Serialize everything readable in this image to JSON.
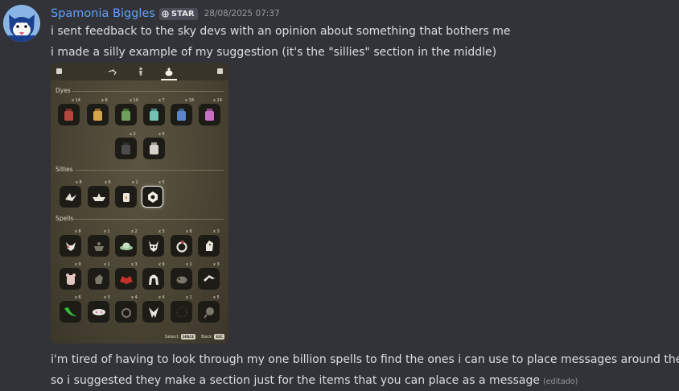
{
  "message": {
    "username": "Spamonia Biggles",
    "tag": "STAR",
    "timestamp": "28/08/2025 07:37",
    "lines": [
      "i sent feedback to the sky devs with an opinion about something that bothers me",
      "i made a silly example of my suggestion (it's the \"sillies\" section in the middle)",
      "i'm tired of having to look through my one billion spells to find the ones i can use to place messages around the map",
      "so i suggested they make a section just for the items that you can place as a message"
    ],
    "edited": "(editado)"
  },
  "colors": {
    "username": "#5fa1ff",
    "background": "#313338",
    "text": "#dbdee1",
    "muted": "#949ba4"
  },
  "screenshot": {
    "sections": {
      "dyes": "Dyes",
      "sillies": "Sillies",
      "spells": "Spells"
    },
    "dyes_counts": [
      "x 14",
      "x 6",
      "x 10",
      "x 7",
      "x 18",
      "x 14",
      "x 2",
      "x 5"
    ],
    "sillies_counts": [
      "x 8",
      "x 6",
      "x 1",
      "x 5"
    ],
    "spells_counts": [
      "x 8",
      "x 1",
      "x 2",
      "x 3",
      "x 6",
      "x 3",
      "x 9",
      "x 1",
      "x 3",
      "x 9",
      "x 1",
      "x 3",
      "x 6",
      "x 3",
      "x 4",
      "x 4",
      "x 1",
      "x 5"
    ],
    "footer": {
      "select": "Select",
      "select_key": "SPACE",
      "back": "Back",
      "back_key": "ESC"
    }
  }
}
